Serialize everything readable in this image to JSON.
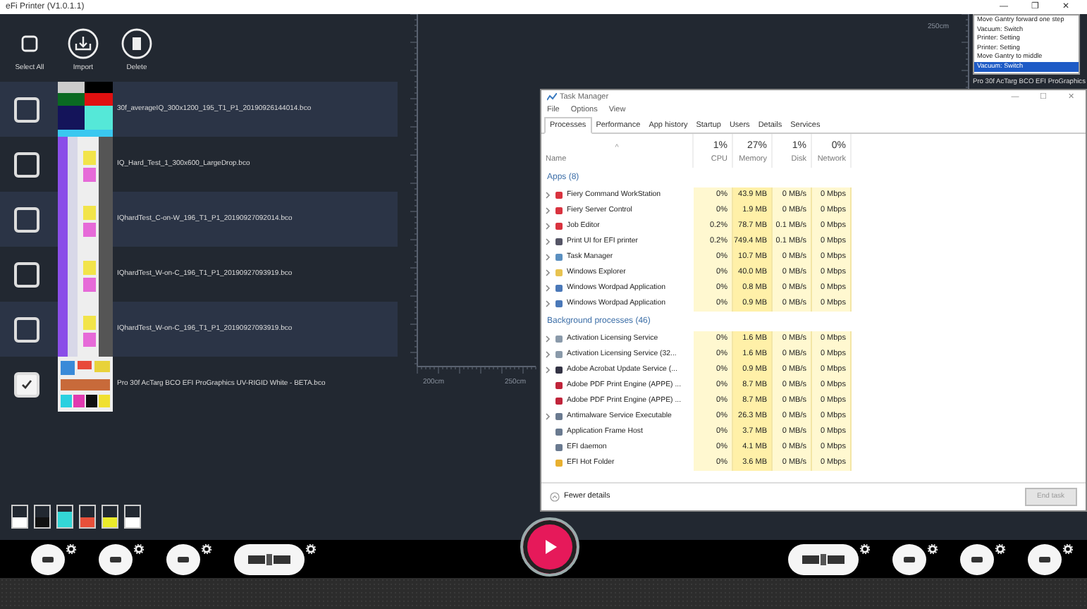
{
  "window": {
    "title": "eFi Printer (V1.0.1.1)",
    "controls": [
      "—",
      "❐",
      "✕"
    ]
  },
  "toolbar": [
    {
      "label": "Select All",
      "kind": "checkbox"
    },
    {
      "label": "Import",
      "kind": "import"
    },
    {
      "label": "Delete",
      "kind": "delete"
    }
  ],
  "files": [
    {
      "name": "30f_averageIQ_300x1200_195_T1_P1_20190926144014.bco",
      "checked": false
    },
    {
      "name": "IQ_Hard_Test_1_300x600_LargeDrop.bco",
      "checked": false
    },
    {
      "name": "IQhardTest_C-on-W_196_T1_P1_20190927092014.bco",
      "checked": false
    },
    {
      "name": "IQhardTest_W-on-C_196_T1_P1_20190927093919.bco",
      "checked": false
    },
    {
      "name": "IQhardTest_W-on-C_196_T1_P1_20190927093919.bco",
      "checked": false
    },
    {
      "name": "Pro 30f AcTarg BCO EFI ProGraphics UV-RIGID White - BETA.bco",
      "checked": true
    }
  ],
  "ruler_labels": [
    "200cm",
    "250cm",
    "250cm"
  ],
  "log": {
    "entries": [
      {
        "text": "Move Gantry forward one step",
        "selected": false
      },
      {
        "text": "Vacuum: Switch",
        "selected": false
      },
      {
        "text": "Printer: Setting",
        "selected": false
      },
      {
        "text": "Printer: Setting",
        "selected": false
      },
      {
        "text": "Move Gantry to middle",
        "selected": false
      },
      {
        "text": "Vacuum: Switch",
        "selected": true
      }
    ],
    "info": "Pro 30f AcTarg BCO EFI ProGraphics"
  },
  "inks": [
    {
      "color": "#ffffff",
      "level": 0.5
    },
    {
      "color": "#111111",
      "level": 0.45
    },
    {
      "color": "#33d6d6",
      "level": 0.75
    },
    {
      "color": "#e8503a",
      "level": 0.5
    },
    {
      "color": "#eaea2a",
      "level": 0.45
    },
    {
      "color": "#ffffff",
      "level": 0.45
    }
  ],
  "bottom_tools_left": [
    {
      "kind": "round"
    },
    {
      "kind": "round"
    },
    {
      "kind": "round"
    },
    {
      "kind": "wide"
    }
  ],
  "bottom_tools_right": [
    {
      "kind": "wide"
    },
    {
      "kind": "round"
    },
    {
      "kind": "round"
    },
    {
      "kind": "round"
    }
  ],
  "task_manager": {
    "title": "Task Manager",
    "controls": [
      "—",
      "☐",
      "✕"
    ],
    "menu": [
      "File",
      "Options",
      "View"
    ],
    "tabs": [
      {
        "label": "Processes",
        "selected": true
      },
      {
        "label": "Performance",
        "selected": false
      },
      {
        "label": "App history",
        "selected": false
      },
      {
        "label": "Startup",
        "selected": false
      },
      {
        "label": "Users",
        "selected": false
      },
      {
        "label": "Details",
        "selected": false
      },
      {
        "label": "Services",
        "selected": false
      }
    ],
    "sort_mark": "^",
    "columns": [
      {
        "label": "Name"
      },
      {
        "label": "CPU",
        "total": "1%"
      },
      {
        "label": "Memory",
        "total": "27%"
      },
      {
        "label": "Disk",
        "total": "1%"
      },
      {
        "label": "Network",
        "total": "0%"
      }
    ],
    "groups": [
      {
        "label": "Apps (8)",
        "rows": [
          {
            "name": "Fiery Command WorkStation",
            "expandable": true,
            "color": "#d9333f",
            "cells": [
              "0%",
              "43.9 MB",
              "0 MB/s",
              "0 Mbps"
            ]
          },
          {
            "name": "Fiery Server Control",
            "expandable": true,
            "color": "#d9333f",
            "cells": [
              "0%",
              "1.9 MB",
              "0 MB/s",
              "0 Mbps"
            ]
          },
          {
            "name": "Job Editor",
            "expandable": true,
            "color": "#d9333f",
            "cells": [
              "0.2%",
              "78.7 MB",
              "0.1 MB/s",
              "0 Mbps"
            ]
          },
          {
            "name": "Print UI for EFI printer",
            "expandable": true,
            "color": "#555566",
            "cells": [
              "0.2%",
              "749.4 MB",
              "0.1 MB/s",
              "0 Mbps"
            ]
          },
          {
            "name": "Task Manager",
            "expandable": true,
            "color": "#5a8fc0",
            "cells": [
              "0%",
              "10.7 MB",
              "0 MB/s",
              "0 Mbps"
            ]
          },
          {
            "name": "Windows Explorer",
            "expandable": true,
            "color": "#e8c350",
            "cells": [
              "0%",
              "40.0 MB",
              "0 MB/s",
              "0 Mbps"
            ]
          },
          {
            "name": "Windows Wordpad Application",
            "expandable": true,
            "color": "#4a78b8",
            "cells": [
              "0%",
              "0.8 MB",
              "0 MB/s",
              "0 Mbps"
            ]
          },
          {
            "name": "Windows Wordpad Application",
            "expandable": true,
            "color": "#4a78b8",
            "cells": [
              "0%",
              "0.9 MB",
              "0 MB/s",
              "0 Mbps"
            ]
          }
        ]
      },
      {
        "label": "Background processes (46)",
        "rows": [
          {
            "name": "Activation Licensing Service",
            "expandable": true,
            "color": "#8a9aaa",
            "cells": [
              "0%",
              "1.6 MB",
              "0 MB/s",
              "0 Mbps"
            ]
          },
          {
            "name": "Activation Licensing Service (32...",
            "expandable": true,
            "color": "#8a9aaa",
            "cells": [
              "0%",
              "1.6 MB",
              "0 MB/s",
              "0 Mbps"
            ]
          },
          {
            "name": "Adobe Acrobat Update Service (...",
            "expandable": true,
            "color": "#333344",
            "cells": [
              "0%",
              "0.9 MB",
              "0 MB/s",
              "0 Mbps"
            ]
          },
          {
            "name": "Adobe PDF Print Engine (APPE) ...",
            "expandable": false,
            "color": "#c0243a",
            "cells": [
              "0%",
              "8.7 MB",
              "0 MB/s",
              "0 Mbps"
            ]
          },
          {
            "name": "Adobe PDF Print Engine (APPE) ...",
            "expandable": false,
            "color": "#c0243a",
            "cells": [
              "0%",
              "8.7 MB",
              "0 MB/s",
              "0 Mbps"
            ]
          },
          {
            "name": "Antimalware Service Executable",
            "expandable": true,
            "color": "#6a7a90",
            "cells": [
              "0%",
              "26.3 MB",
              "0 MB/s",
              "0 Mbps"
            ]
          },
          {
            "name": "Application Frame Host",
            "expandable": false,
            "color": "#6a7a90",
            "cells": [
              "0%",
              "3.7 MB",
              "0 MB/s",
              "0 Mbps"
            ]
          },
          {
            "name": "EFI daemon",
            "expandable": false,
            "color": "#6a7a90",
            "cells": [
              "0%",
              "4.1 MB",
              "0 MB/s",
              "0 Mbps"
            ]
          },
          {
            "name": "EFI Hot Folder",
            "expandable": false,
            "color": "#e8b030",
            "cells": [
              "0%",
              "3.6 MB",
              "0 MB/s",
              "0 Mbps"
            ]
          }
        ]
      }
    ],
    "fewer_details": "Fewer details",
    "end_task": {
      "label": "End task",
      "disabled": true
    }
  }
}
